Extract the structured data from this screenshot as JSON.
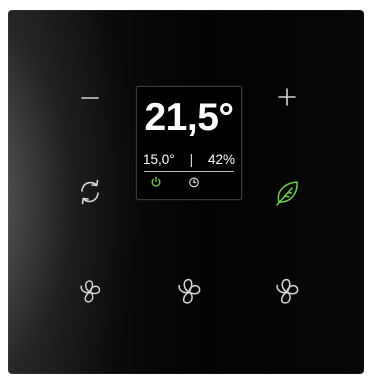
{
  "display": {
    "temperature": "21,5°",
    "setpoint": "15,0°",
    "separator": "|",
    "humidity": "42%"
  },
  "icons": {
    "top_left": "minus-icon",
    "top_right": "plus-icon",
    "mid_left": "sync-icon",
    "mid_right": "leaf-icon",
    "display_left": "power-icon",
    "display_right": "clock-icon",
    "bottom": [
      "fan-icon",
      "fan-icon",
      "fan-icon"
    ]
  },
  "colors": {
    "panel": "#050505",
    "icon": "#d9d9d9",
    "accent_green": "#6ccf3e",
    "display_text": "#ffffff"
  }
}
